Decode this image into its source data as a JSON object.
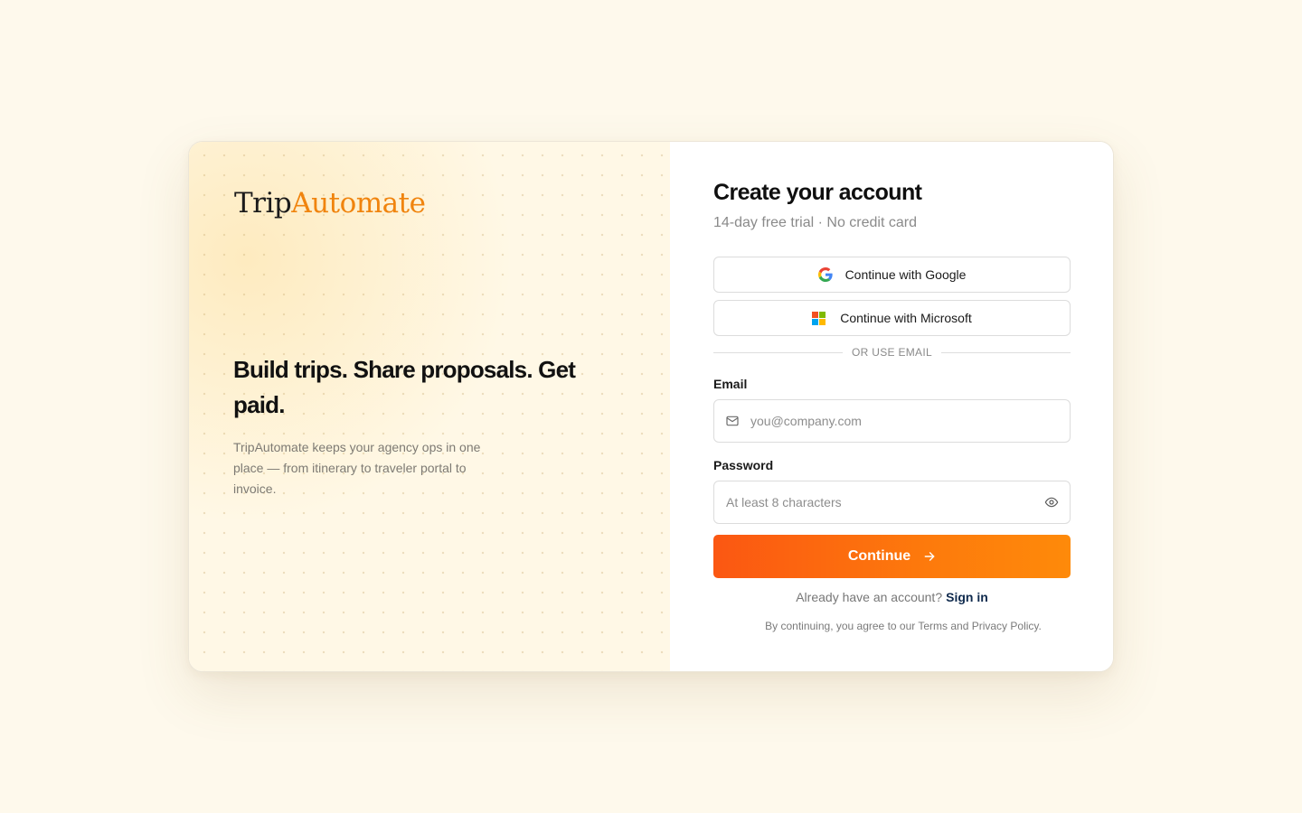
{
  "brand": {
    "name_part1": "Trip",
    "name_part2": "Automate",
    "accent_color": "#f0840e"
  },
  "hero": {
    "headline": "Build trips. Share proposals. Get paid.",
    "description": "TripAutomate keeps your agency ops in one place — from itinerary to traveler portal to invoice."
  },
  "signup": {
    "title": "Create your account",
    "subtitle": "14-day free trial · No credit card",
    "google_label": "Continue with Google",
    "microsoft_label": "Continue with Microsoft",
    "divider_text": "OR USE EMAIL",
    "email_label": "Email",
    "email_placeholder": "you@company.com",
    "email_value": "",
    "password_label": "Password",
    "password_placeholder": "At least 8 characters",
    "password_value": "",
    "continue_label": "Continue",
    "signin_prompt": "Already have an account?",
    "signin_link": "Sign in",
    "legal_text": "By continuing, you agree to our Terms and Privacy Policy."
  },
  "icons": {
    "google": "google-icon",
    "microsoft": "microsoft-icon",
    "mail": "mail-icon",
    "eye": "eye-icon",
    "arrow": "arrow-right-icon"
  },
  "colors": {
    "page_background": "#fef9ec",
    "primary_button_start": "#fb5712",
    "primary_button_end": "#fe8a0a",
    "link": "#0f2a4d"
  }
}
